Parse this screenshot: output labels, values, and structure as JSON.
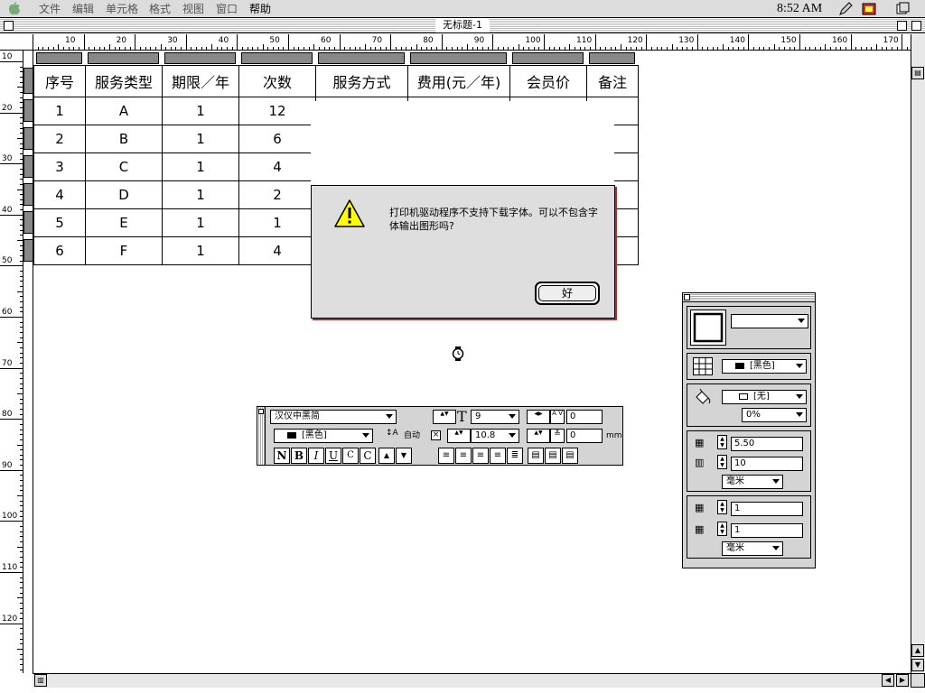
{
  "menubar": {
    "items": [
      {
        "label": "文件"
      },
      {
        "label": "编辑"
      },
      {
        "label": "单元格"
      },
      {
        "label": "格式"
      },
      {
        "label": "视图"
      },
      {
        "label": "窗口"
      },
      {
        "label": "帮助"
      }
    ],
    "clock": "8:52 AM"
  },
  "window": {
    "title": "无标题-1"
  },
  "ruler": {
    "h_labels": [
      "10",
      "20",
      "30",
      "40",
      "50",
      "60",
      "70",
      "80",
      "90",
      "100",
      "110",
      "120",
      "130",
      "140",
      "150",
      "160",
      "170"
    ],
    "v_labels": [
      "10",
      "20",
      "30",
      "40",
      "50",
      "60",
      "70",
      "80",
      "90",
      "100",
      "110",
      "120"
    ]
  },
  "table": {
    "headers": [
      "序号",
      "服务类型",
      "期限／年",
      "次数",
      "服务方式",
      "费用(元／年)",
      "会员价",
      "备注"
    ],
    "rows": [
      [
        "1",
        "A",
        "1",
        "12",
        "",
        "",
        "",
        ""
      ],
      [
        "2",
        "B",
        "1",
        "6",
        "",
        "",
        "",
        ""
      ],
      [
        "3",
        "C",
        "1",
        "4",
        "",
        "",
        "",
        ""
      ],
      [
        "4",
        "D",
        "1",
        "2",
        "",
        "",
        "",
        ""
      ],
      [
        "5",
        "E",
        "1",
        "1",
        "",
        "",
        "",
        ""
      ],
      [
        "6",
        "F",
        "1",
        "4",
        "",
        "",
        "",
        ""
      ]
    ]
  },
  "alert": {
    "message": "打印机驱动程序不支持下载字体。可以不包含字体输出图形吗?",
    "ok_label": "好"
  },
  "text_palette": {
    "font": "汉仪中黑简",
    "size": "9",
    "tracking": "0",
    "color": "[黑色]",
    "leading_auto": "自动",
    "leading": "10.8",
    "baseline": "0",
    "unit": "mm",
    "style_buttons": [
      "N",
      "B",
      "I",
      "U",
      "C",
      "C"
    ]
  },
  "cell_palette": {
    "border_style": "",
    "grid_color": "[黑色]",
    "fill_color": "[无]",
    "shade": "0%",
    "width": "5.50",
    "height": "10",
    "unit1": "毫米",
    "cols": "1",
    "rows": "1",
    "unit2": "毫米"
  }
}
